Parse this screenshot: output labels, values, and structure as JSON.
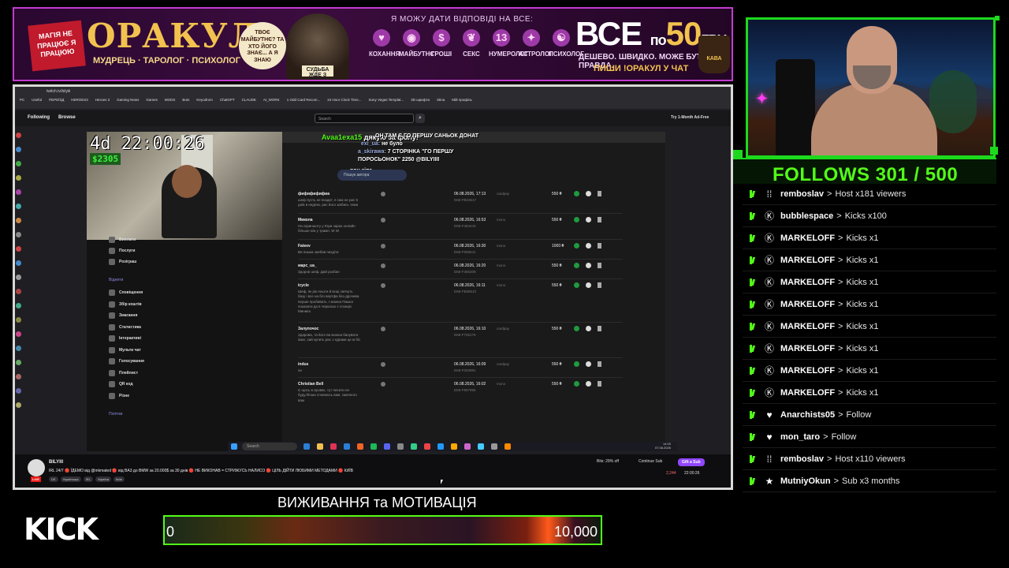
{
  "banner": {
    "note": "МАГІЯ НЕ ПРАЦЮЄ Я ПРАЦЮЮ",
    "brand": "ОРАКУЛ",
    "subtitle": "МУДРЕЦЬ · ТАРОЛОГ · ПСИХОЛОГ",
    "bubble": "ТВОЄ МАЙБУТНЄ? ТА ХТО ЙОГО ЗНАЄ... А Я ЗНАЮ",
    "wizard_caption": "СУДЬБА ЖДЕ З ТЕБЕ",
    "tagline": "Я МОЖУ ДАТИ ВІДПОВІДІ НА ВСЕ:",
    "categories": [
      {
        "label": "КОХАННЯ",
        "icon": "heart-icon",
        "glyph": "♥"
      },
      {
        "label": "МАЙБУТНЄ",
        "icon": "crystal-ball-icon",
        "glyph": "◉"
      },
      {
        "label": "ГРОШІ",
        "icon": "money-icon",
        "glyph": "$"
      },
      {
        "label": "СЕКС",
        "icon": "apple-icon",
        "glyph": "❦"
      },
      {
        "label": "НУМЕРОЛОГ",
        "icon": "numbers-icon",
        "glyph": "13"
      },
      {
        "label": "АСТРОЛОГ",
        "icon": "astrology-icon",
        "glyph": "✦"
      },
      {
        "label": "ПСИХОЛОГ",
        "icon": "brain-icon",
        "glyph": "☯"
      }
    ],
    "price_word": "ВСЕ",
    "price_pre": "по",
    "price_num": "50",
    "price_cur": "ГРН.",
    "price_sub": "ДЕШЕВО. ШВИДКО. МОЖЕ БУТИ ПРАВДА.",
    "cta": "ПИШИ !ОРАКУЛ У ЧАТ",
    "cup": "КАВА"
  },
  "browser": {
    "url": "twitch.tv/bilyiii",
    "bookmarks": [
      "PC",
      "Useful",
      "ПЕРЕЇЗД",
      "HEROES3",
      "Heroes 3",
      "Gaming News",
      "Games",
      "MODS",
      "Bots",
      "Keyodrom",
      "ChatGPT",
      "CLAUDE",
      "AI_WORK",
      "1 Odd Card Recom...",
      "24 Hour Clock Time...",
      "Sony Vegas Templat...",
      "3D шрифти",
      "Stina",
      "Мій профіль"
    ],
    "nav_following": "Following",
    "nav_browse": "Browse",
    "search_placeholder": "Search",
    "adfree": "Try 1-Month Ad-Free"
  },
  "stream_overlay": {
    "timer": "4d 22:00:26",
    "money": "$2305",
    "alert_user": "Avaa1exa15",
    "alert_text": "дякую за фолу!",
    "chat": [
      {
        "user": "",
        "text": "ОН ТАМ Є ГО ПЕРШУ САНЬОК ДОНАТ"
      },
      {
        "user": "exi_ua:",
        "text": "не було"
      },
      {
        "user": "a_skirawa:",
        "text": "7 СТОРІНКА \"ГО ПЕРШУ"
      },
      {
        "user": "",
        "text": "ПОРОСЬОНОК\" 2250 @BILYIIII"
      },
      {
        "user": "",
        "text": "вон зіпа"
      }
    ]
  },
  "admin": {
    "search_placeholder": "Пошук автора",
    "orders": [
      {
        "name": "фифифифифиа",
        "msg": "шеф пусть не пиздит, я сам не рис 5 днів в неділю, рис його заїбись тема",
        "date": "06.08.2026, 17:13",
        "id": "D68-FB23517",
        "method": "cardpay",
        "amount": "550 ₴"
      },
      {
        "name": "Микола",
        "msg": "На скриншоту у Юри зараз онлайн більше ніж у трамп. W W",
        "date": "06.08.2026, 16:53",
        "id": "D68-F484443",
        "method": "mono",
        "amount": "550 ₴"
      },
      {
        "name": "Fateev",
        "msg": "Ви пиыка заебав пиздіти",
        "date": "06.08.2026, 16:30",
        "id": "D68-F958541",
        "method": "mono",
        "amount": "1000 ₴"
      },
      {
        "name": "марс_ua_",
        "msg": "Здоров шеф. Дай розбан",
        "date": "06.08.2026, 16:20",
        "id": "D68-F355208",
        "method": "mono",
        "amount": "550 ₴"
      },
      {
        "name": "icycle",
        "msg": "Шеф, як рік пошти й кінці свячуть базу і все на бго вертфа без дрочива перше пробивать. І можна Пиыка показати да в черкаськ є позиціє Миника",
        "date": "06.08.2026, 16:11",
        "id": "D68-FB58510",
        "method": "mono",
        "amount": "550 ₴"
      },
      {
        "name": "Залупочос",
        "msg": "Здарова, та його ви можна банувати іаже, хай купить рис з курами це м біс",
        "date": "06.08.2026, 16:10",
        "id": "D68-F705175",
        "method": "cardpay",
        "amount": "550 ₴"
      },
      {
        "name": "indus",
        "msg": "хи",
        "date": "06.08.2026, 16:09",
        "id": "D68-F003991",
        "method": "cardpay",
        "amount": "550 ₴"
      },
      {
        "name": "Christian Bell",
        "msg": "Є щось в провек, тут писати не буду.Ліпши сповнюсь вам, смачного вам",
        "date": "06.08.2026, 16:02",
        "id": "D68-F857996",
        "method": "mono",
        "amount": "550 ₴"
      }
    ],
    "pager": [
      "1",
      "...",
      "6",
      "7",
      "8",
      "...",
      "522"
    ],
    "pager_current": "7",
    "menu": [
      {
        "label": "Виплати"
      },
      {
        "label": "Послуги"
      },
      {
        "label": "Розіграш"
      }
    ],
    "section": "Віджети",
    "widgets": [
      {
        "label": "Сповіщення"
      },
      {
        "label": "Збір коштів"
      },
      {
        "label": "Змагання"
      },
      {
        "label": "Статистика"
      },
      {
        "label": "Інтерактиві"
      },
      {
        "label": "Мульти чат"
      },
      {
        "label": "Голосування"
      },
      {
        "label": "Плейлист"
      },
      {
        "label": "QR код"
      },
      {
        "label": "Різне"
      }
    ],
    "section2": "Попітки",
    "taskbar_search": "Search",
    "clock_time": "14:00",
    "clock_date": "07.08.2026"
  },
  "infobar": {
    "channel": "BILYIII",
    "live": "LIVE",
    "title": "IRL 24/7 🔴 ЇДЕМО від @mkmated 🔴 від BA3 до BMW за 20.000$ за 30 днів 🔴 НЕ ВИКОНАВ = СТРИЖУСЬ НАЛИСО 🔴 ЦІЛЬ ДІЙТИ ЛЮБИМИ МЕТОДАМИ 🔴 КИЇВ",
    "tags": [
      "DE",
      "Українська",
      "IRL",
      "Україна",
      "Київ"
    ],
    "bits": "Bits: 29% off",
    "continue": "Continue Sub",
    "gift": "Gift a Sub",
    "viewers": "2,244",
    "uptime": "22:00:26"
  },
  "follows": {
    "text": "FOLLOWS 301 / 500",
    "current": 301,
    "goal": 500
  },
  "events": [
    {
      "user": "remboslav",
      "text": "Host x181 viewers",
      "icon": "host-icon",
      "glyph": "⁞⁞"
    },
    {
      "user": "bubblespace",
      "text": "Kicks x100",
      "icon": "kicks-icon",
      "glyph": "Ⓚ"
    },
    {
      "user": "MARKELOFF",
      "text": "Kicks x1",
      "icon": "kicks-icon",
      "glyph": "Ⓚ"
    },
    {
      "user": "MARKELOFF",
      "text": "Kicks x1",
      "icon": "kicks-icon",
      "glyph": "Ⓚ"
    },
    {
      "user": "MARKELOFF",
      "text": "Kicks x1",
      "icon": "kicks-icon",
      "glyph": "Ⓚ"
    },
    {
      "user": "MARKELOFF",
      "text": "Kicks x1",
      "icon": "kicks-icon",
      "glyph": "Ⓚ"
    },
    {
      "user": "MARKELOFF",
      "text": "Kicks x1",
      "icon": "kicks-icon",
      "glyph": "Ⓚ"
    },
    {
      "user": "MARKELOFF",
      "text": "Kicks x1",
      "icon": "kicks-icon",
      "glyph": "Ⓚ"
    },
    {
      "user": "MARKELOFF",
      "text": "Kicks x1",
      "icon": "kicks-icon",
      "glyph": "Ⓚ"
    },
    {
      "user": "MARKELOFF",
      "text": "Kicks x1",
      "icon": "kicks-icon",
      "glyph": "Ⓚ"
    },
    {
      "user": "Anarchists05",
      "text": "Follow",
      "icon": "heart-icon",
      "glyph": "♥"
    },
    {
      "user": "mon_taro",
      "text": "Follow",
      "icon": "heart-icon",
      "glyph": "♥"
    },
    {
      "user": "remboslav",
      "text": "Host x110 viewers",
      "icon": "host-icon",
      "glyph": "⁞⁞"
    },
    {
      "user": "MutniyOkun",
      "text": "Sub x3 months",
      "icon": "star-icon",
      "glyph": "★"
    }
  ],
  "event_arrow": ">",
  "bottom": {
    "kick_logo": "KICK",
    "goal_title": "ВИЖИВАННЯ та МОТИВАЦІЯ",
    "goal_min": "0",
    "goal_max": "10,000"
  },
  "colors": {
    "kick_green": "#53fc18",
    "banner_purple": "#c33bd0",
    "twitch_purple": "#9147ff"
  }
}
